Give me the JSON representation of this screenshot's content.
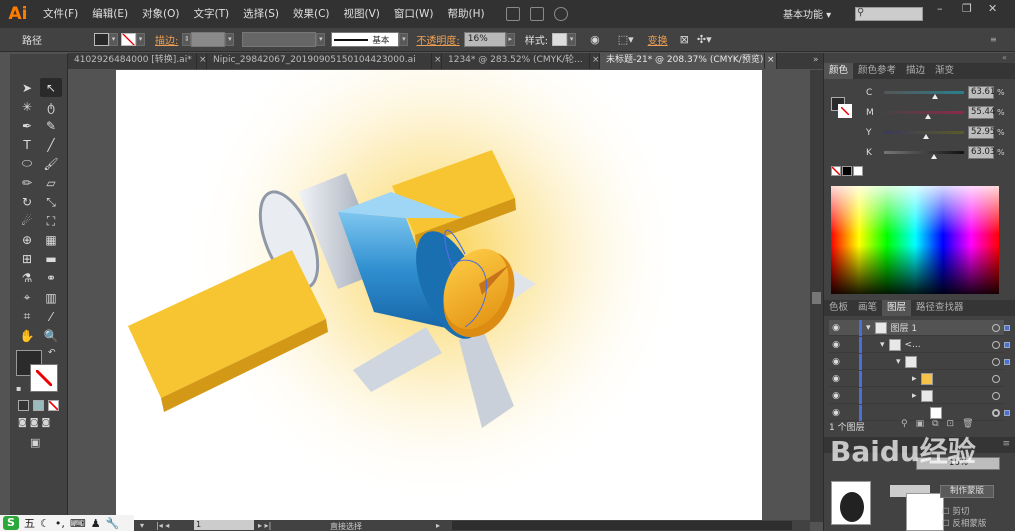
{
  "menubar": {
    "logo": "Ai",
    "items": [
      "文件(F)",
      "编辑(E)",
      "对象(O)",
      "文字(T)",
      "选择(S)",
      "效果(C)",
      "视图(V)",
      "窗口(W)",
      "帮助(H)"
    ],
    "workspace": "基本功能",
    "window_controls": [
      "–",
      "❐",
      "✕"
    ]
  },
  "controlbar": {
    "object_label": "路径",
    "stroke_label": "描边:",
    "stroke_style": "基本",
    "opacity_label": "不透明度:",
    "opacity_value": "16%",
    "style_label": "样式:",
    "transform_label": "变换"
  },
  "doc_tabs": [
    {
      "label": "4102926484000 [转换].ai*"
    },
    {
      "label": "Nipic_29842067_20190905150104423000.ai"
    },
    {
      "label": "1234* @ 283.52% (CMYK/轮..."
    },
    {
      "label": "未标题-21* @ 208.37% (CMYK/预览)"
    }
  ],
  "color_panel": {
    "tabs": [
      "颜色",
      "颜色参考",
      "描边",
      "渐变"
    ],
    "channels": [
      {
        "name": "C",
        "value": "63.61",
        "unit": "%",
        "level": 0.64
      },
      {
        "name": "M",
        "value": "55.44",
        "unit": "%",
        "level": 0.55
      },
      {
        "name": "Y",
        "value": "52.95",
        "unit": "%",
        "level": 0.53
      },
      {
        "name": "K",
        "value": "63.03",
        "unit": "%",
        "level": 0.63
      }
    ]
  },
  "layers_panel": {
    "tabs": [
      "色板",
      "画笔",
      "图层",
      "路径查找器"
    ],
    "rows": [
      {
        "label": "图层 1"
      },
      {
        "label": "<..."
      },
      {
        "label": ""
      },
      {
        "label": ""
      },
      {
        "label": ""
      },
      {
        "label": ""
      }
    ],
    "footer": "1 个图层"
  },
  "transparency_panel": {
    "opacity_value": "16%",
    "mask_button": "制作蒙版",
    "clip_label": "剪切",
    "invert_label": "反相蒙版"
  },
  "statusbar": {
    "tool_name": "直接选择"
  },
  "ime": {
    "logo": "S",
    "mode": "五"
  },
  "watermark": "Baidu经验"
}
